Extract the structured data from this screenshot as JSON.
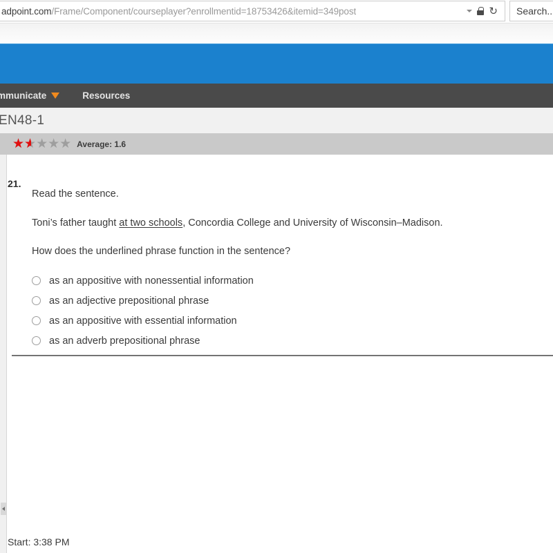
{
  "browser": {
    "url_host": "adpoint.com",
    "url_path": "/Frame/Component/courseplayer?enrollmentid=18753426&itemid=349post",
    "url_full": "adpoint.com/Frame/Component/courseplayer?enrollmentid=18753426&itemid=349post",
    "dropdown_icon": "chevron-down-icon",
    "lock_icon": "lock-icon",
    "reload_icon": "reload-icon",
    "reload_glyph": "↻",
    "search_placeholder": "Search...",
    "search_value": "Search..."
  },
  "nav": {
    "items": [
      {
        "label": "mmunicate",
        "has_caret": true
      },
      {
        "label": "Resources",
        "has_caret": false
      }
    ],
    "caret_color": "#f08a1e",
    "background": "#4a4a4a"
  },
  "header": {
    "band_color": "#1b81ce",
    "title": "EN48-1"
  },
  "rating": {
    "stars_base": "★★★★★",
    "stars_filled": "★★★★★",
    "value": 1.6,
    "max": 5,
    "fill_percent": "32%",
    "average_label": "Average: 1.6",
    "filled_color": "#e10e0e",
    "empty_color": "#9e9e9e"
  },
  "question": {
    "number": "21.",
    "prompt_line1": "Read the sentence.",
    "sentence_prefix": "Toni’s father taught ",
    "sentence_underlined": "at two schools",
    "sentence_suffix": ", Concordia College and University of Wisconsin–Madison.",
    "prompt_line3": "How does the underlined phrase function in the sentence?",
    "options": [
      {
        "label": "as an appositive with nonessential information",
        "selected": false
      },
      {
        "label": "as an adjective prepositional phrase",
        "selected": false
      },
      {
        "label": "as an appositive with essential information",
        "selected": false
      },
      {
        "label": "as an adverb prepositional phrase",
        "selected": false
      }
    ]
  },
  "status": {
    "start_label": "Start: 3:38 PM"
  }
}
